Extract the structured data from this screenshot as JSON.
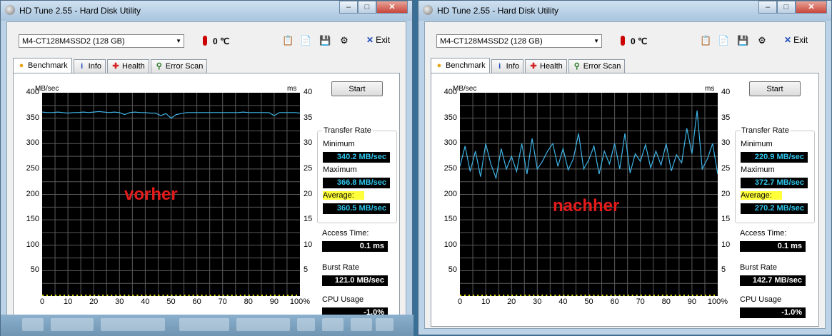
{
  "windows": [
    {
      "title": "HD Tune 2.55 - Hard Disk Utility",
      "drive": "M4-CT128M4SSD2 (128 GB)",
      "temperature": "0 ℃",
      "exit_label": "Exit",
      "tabs": [
        "Benchmark",
        "Info",
        "Health",
        "Error Scan"
      ],
      "tab_icons": [
        "benchmark-icon",
        "info-icon",
        "health-icon",
        "error-scan-icon"
      ],
      "start_label": "Start",
      "y_unit": "MB/sec",
      "y2_unit": "ms",
      "transfer_rate_title": "Transfer Rate",
      "minimum_label": "Minimum",
      "minimum_value": "340.2 MB/sec",
      "maximum_label": "Maximum",
      "maximum_value": "366.8 MB/sec",
      "average_label": "Average:",
      "average_value": "360.5 MB/sec",
      "access_label": "Access Time:",
      "access_value": "0.1 ms",
      "burst_label": "Burst Rate",
      "burst_value": "121.0 MB/sec",
      "cpu_label": "CPU Usage",
      "cpu_value": "-1.0%",
      "overlay_label": "vorher"
    },
    {
      "title": "HD Tune 2.55 - Hard Disk Utility",
      "drive": "M4-CT128M4SSD2 (128 GB)",
      "temperature": "0 ℃",
      "exit_label": "Exit",
      "tabs": [
        "Benchmark",
        "Info",
        "Health",
        "Error Scan"
      ],
      "tab_icons": [
        "benchmark-icon",
        "info-icon",
        "health-icon",
        "error-scan-icon"
      ],
      "start_label": "Start",
      "y_unit": "MB/sec",
      "y2_unit": "ms",
      "transfer_rate_title": "Transfer Rate",
      "minimum_label": "Minimum",
      "minimum_value": "220.9 MB/sec",
      "maximum_label": "Maximum",
      "maximum_value": "372.7 MB/sec",
      "average_label": "Average:",
      "average_value": "270.2 MB/sec",
      "access_label": "Access Time:",
      "access_value": "0.1 ms",
      "burst_label": "Burst Rate",
      "burst_value": "142.7 MB/sec",
      "cpu_label": "CPU Usage",
      "cpu_value": "-1.0%",
      "overlay_label": "nachher"
    }
  ],
  "colors": {
    "transfer_line": "#3fb4e6",
    "grid": "#5a5a5a",
    "access_points": "#e6e600",
    "stat_cyan": "#2fc6ec",
    "highlight": "#ffff3a",
    "overlay_red": "#e41b1b"
  },
  "chart_data": [
    {
      "type": "line",
      "title": "",
      "xlabel": "",
      "ylabel": "MB/sec",
      "y2label": "ms",
      "xlim": [
        0,
        100
      ],
      "ylim": [
        0,
        400
      ],
      "y2lim": [
        0,
        40
      ],
      "xticks": [
        "0",
        "10",
        "20",
        "30",
        "40",
        "50",
        "60",
        "70",
        "80",
        "90",
        "100%"
      ],
      "yticks": [
        "400",
        "350",
        "300",
        "250",
        "200",
        "150",
        "100",
        "50"
      ],
      "y2ticks": [
        "40",
        "35",
        "30",
        "25",
        "20",
        "15",
        "10",
        "5"
      ],
      "grid": true,
      "series": [
        {
          "x": [
            0,
            2,
            4,
            6,
            8,
            10,
            12,
            14,
            16,
            18,
            20,
            22,
            24,
            26,
            28,
            30,
            32,
            34,
            36,
            38,
            40,
            42,
            44,
            46,
            48,
            50,
            52,
            54,
            56,
            58,
            60,
            62,
            64,
            66,
            68,
            70,
            72,
            74,
            76,
            78,
            80,
            82,
            84,
            86,
            88,
            90,
            92,
            94,
            96,
            98,
            100
          ],
          "values": [
            362,
            361,
            361,
            362,
            361,
            360,
            361,
            361,
            362,
            361,
            362,
            363,
            362,
            361,
            362,
            361,
            357,
            361,
            362,
            361,
            361,
            360,
            360,
            355,
            359,
            350,
            357,
            359,
            361,
            361,
            361,
            361,
            361,
            361,
            361,
            361,
            361,
            361,
            361,
            362,
            361,
            361,
            361,
            361,
            361,
            355,
            361,
            361,
            361,
            361,
            360
          ]
        }
      ]
    },
    {
      "type": "line",
      "title": "",
      "xlabel": "",
      "ylabel": "MB/sec",
      "y2label": "ms",
      "xlim": [
        0,
        100
      ],
      "ylim": [
        0,
        400
      ],
      "y2lim": [
        0,
        40
      ],
      "xticks": [
        "0",
        "10",
        "20",
        "30",
        "40",
        "50",
        "60",
        "70",
        "80",
        "90",
        "100%"
      ],
      "yticks": [
        "400",
        "350",
        "300",
        "250",
        "200",
        "150",
        "100",
        "50"
      ],
      "y2ticks": [
        "40",
        "35",
        "30",
        "25",
        "20",
        "15",
        "10",
        "5"
      ],
      "grid": true,
      "series": [
        {
          "x": [
            0,
            2,
            4,
            6,
            8,
            10,
            12,
            14,
            16,
            18,
            20,
            22,
            24,
            26,
            28,
            30,
            32,
            34,
            36,
            38,
            40,
            42,
            44,
            46,
            48,
            50,
            52,
            54,
            56,
            58,
            60,
            62,
            64,
            66,
            68,
            70,
            72,
            74,
            76,
            78,
            80,
            82,
            84,
            86,
            88,
            90,
            92,
            94,
            96,
            98,
            100
          ],
          "values": [
            255,
            295,
            245,
            285,
            235,
            300,
            260,
            232,
            290,
            250,
            275,
            245,
            300,
            240,
            310,
            250,
            265,
            285,
            300,
            255,
            290,
            248,
            270,
            320,
            250,
            268,
            295,
            240,
            285,
            260,
            300,
            250,
            320,
            242,
            280,
            265,
            298,
            252,
            285,
            258,
            300,
            246,
            278,
            262,
            330,
            280,
            365,
            250,
            270,
            300,
            240
          ]
        }
      ]
    }
  ]
}
